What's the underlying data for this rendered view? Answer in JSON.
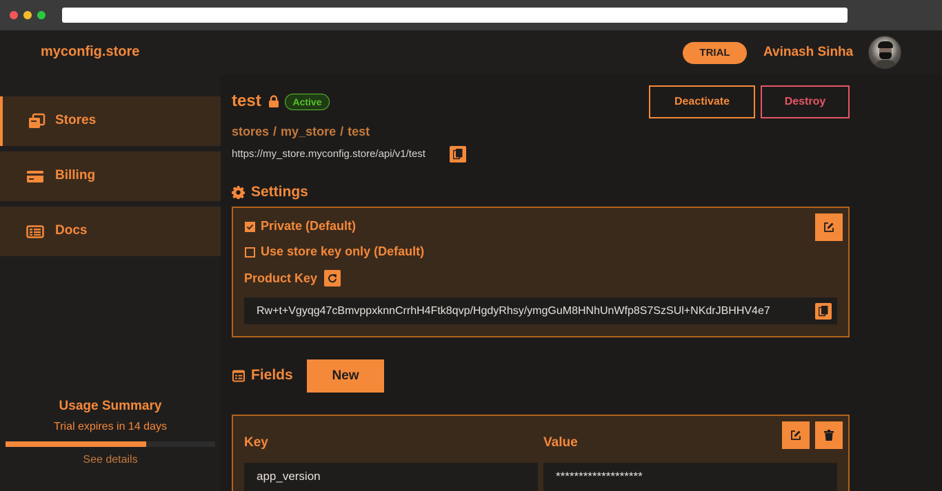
{
  "header": {
    "logo": "myconfig.store",
    "trial_badge": "TRIAL",
    "user_name": "Avinash Sinha"
  },
  "sidebar": {
    "items": [
      {
        "label": "Stores",
        "icon": "stores-icon",
        "active": true
      },
      {
        "label": "Billing",
        "icon": "credit-card-icon",
        "active": false
      },
      {
        "label": "Docs",
        "icon": "docs-icon",
        "active": false
      }
    ],
    "usage": {
      "title": "Usage Summary",
      "subtitle": "Trial expires in 14 days",
      "progress_percent": 67,
      "link": "See details"
    }
  },
  "store": {
    "name": "test",
    "status": "Active",
    "deactivate_label": "Deactivate",
    "destroy_label": "Destroy",
    "breadcrumb": [
      "stores",
      "my_store",
      "test"
    ],
    "endpoint": "https://my_store.myconfig.store/api/v1/test"
  },
  "settings": {
    "title": "Settings",
    "private_label": "Private (Default)",
    "private_checked": true,
    "store_key_label": "Use store key only (Default)",
    "store_key_checked": false,
    "product_key_label": "Product Key",
    "product_key_value": "Rw+t+Vgyqg47cBmvppxknnCrrhH4Ftk8qvp/HgdyRhsy/ymgGuM8HNhUnWfp8S7SzSUl+NKdrJBHHV4e7"
  },
  "fields": {
    "title": "Fields",
    "new_label": "New",
    "key_header": "Key",
    "value_header": "Value",
    "rows": [
      {
        "key": "app_version",
        "value": "*******************"
      }
    ]
  },
  "colors": {
    "accent": "#f5893a",
    "panel": "#3a2a1c",
    "active_status": "#59c02f",
    "danger": "#e55665"
  }
}
